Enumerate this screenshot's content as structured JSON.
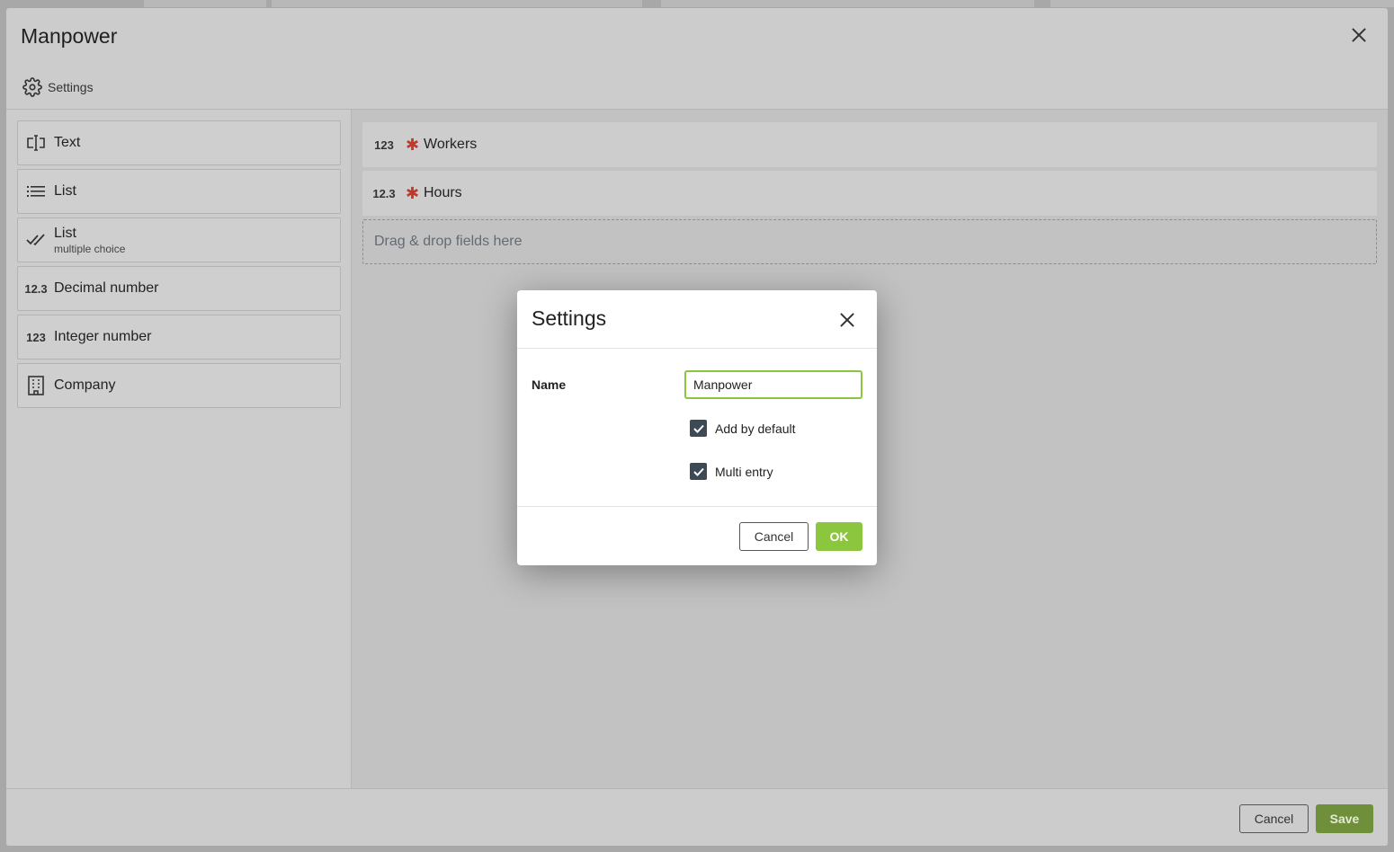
{
  "main_modal": {
    "title": "Manpower",
    "tab_settings_label": "Settings",
    "footer": {
      "cancel_label": "Cancel",
      "save_label": "Save"
    }
  },
  "field_palette": [
    {
      "label": "Text",
      "icon": "text-field-icon"
    },
    {
      "label": "List",
      "icon": "list-icon"
    },
    {
      "label": "List",
      "sublabel": "multiple choice",
      "icon": "double-check-icon"
    },
    {
      "label": "Decimal number",
      "icon": "decimal-number-icon",
      "glyph": "12.3"
    },
    {
      "label": "Integer number",
      "icon": "integer-number-icon",
      "glyph": "123"
    },
    {
      "label": "Company",
      "icon": "building-icon"
    }
  ],
  "form_fields": [
    {
      "label": "Workers",
      "glyph": "123",
      "required": true
    },
    {
      "label": "Hours",
      "glyph": "12.3",
      "required": true
    }
  ],
  "drop_zone_text": "Drag & drop fields here",
  "settings_dialog": {
    "title": "Settings",
    "name_label": "Name",
    "name_value": "Manpower",
    "add_by_default_label": "Add by default",
    "add_by_default_checked": true,
    "multi_entry_label": "Multi entry",
    "multi_entry_checked": true,
    "cancel_label": "Cancel",
    "ok_label": "OK"
  },
  "colors": {
    "accent_green": "#8cc63f",
    "required_red": "#c0392b",
    "checkbox_dark": "#3d4a55"
  }
}
